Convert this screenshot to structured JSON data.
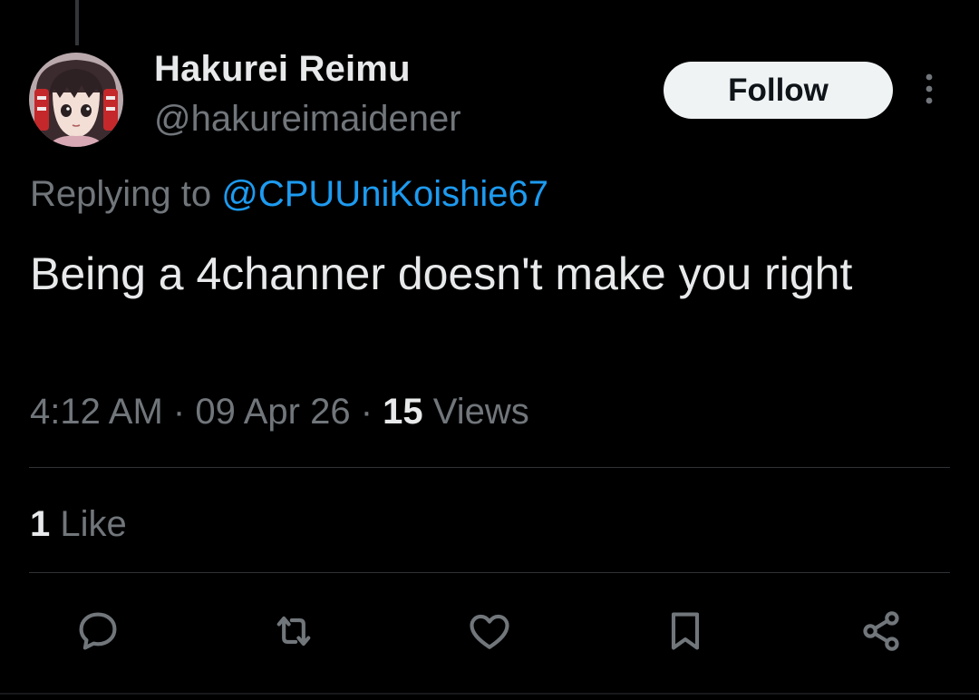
{
  "author": {
    "display_name": "Hakurei Reimu",
    "handle": "@hakureimaidener",
    "avatar_icon": "anime-girl-avatar"
  },
  "follow_label": "Follow",
  "more_icon": "more-vertical-icon",
  "reply_context": {
    "prefix": "Replying to",
    "mention": "@CPUUniKoishie67"
  },
  "tweet": {
    "text": "Being a 4channer doesn't make you right"
  },
  "meta": {
    "time": "4:12 AM",
    "separator": "·",
    "date": "09 Apr 26",
    "views_count": "15",
    "views_label": "Views"
  },
  "likes": {
    "count": "1",
    "label": "Like"
  },
  "actions": [
    {
      "icon": "reply-icon"
    },
    {
      "icon": "repost-icon"
    },
    {
      "icon": "like-icon"
    },
    {
      "icon": "bookmark-icon"
    },
    {
      "icon": "share-icon"
    }
  ],
  "colors": {
    "background": "#000000",
    "text_primary": "#e7e9ea",
    "text_secondary": "#71767b",
    "link": "#1d9bf0",
    "divider": "#2f3336",
    "follow_bg": "#eff3f4"
  }
}
